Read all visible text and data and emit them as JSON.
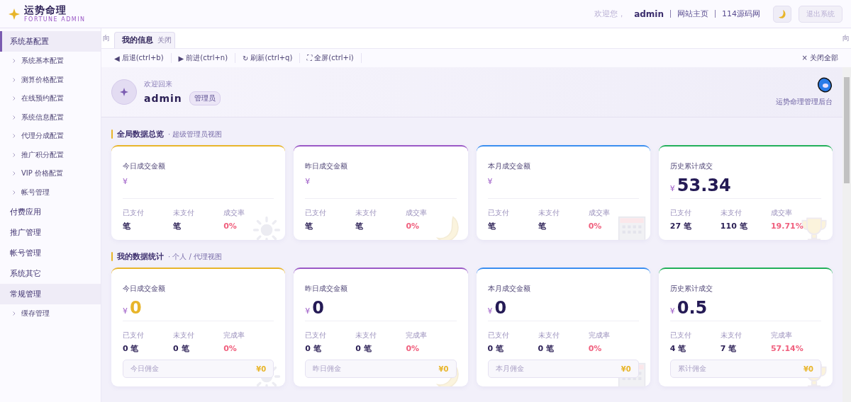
{
  "brand": {
    "title": "运势命理",
    "subtitle": "FORTUNE ADMIN"
  },
  "header": {
    "greeting": "欢迎您，",
    "user": "admin",
    "links": [
      "网站主页",
      "114源码网"
    ],
    "logout": "退出系统"
  },
  "sidebar": {
    "items": [
      {
        "label": "系统基配置",
        "selected": true,
        "expanded": true,
        "children": [
          {
            "label": "系统基本配置"
          },
          {
            "label": "测算价格配置"
          },
          {
            "label": "在线预约配置"
          },
          {
            "label": "系统信息配置"
          },
          {
            "label": "代理分成配置"
          },
          {
            "label": "推广积分配置"
          },
          {
            "label": "VIP 价格配置"
          },
          {
            "label": "帐号管理"
          }
        ]
      },
      {
        "label": "付费应用",
        "selected": false,
        "expanded": false
      },
      {
        "label": "推广管理",
        "selected": false,
        "expanded": false
      },
      {
        "label": "帐号管理",
        "selected": false,
        "expanded": false
      },
      {
        "label": "系统其它",
        "selected": false,
        "expanded": false
      },
      {
        "label": "常规管理",
        "selected": false,
        "expanded": true,
        "children": [
          {
            "label": "缓存管理"
          }
        ]
      }
    ]
  },
  "tab_bar": {
    "left_arrow": "向",
    "right_arrow": "向",
    "tabs": [
      {
        "label": "我的信息",
        "close": "关闭",
        "selected": true
      }
    ]
  },
  "toolbar": {
    "buttons": [
      {
        "icon": "◀",
        "label": "后退(ctrl+b)"
      },
      {
        "icon": "▶",
        "label": "前进(ctrl+n)"
      },
      {
        "icon": "↻",
        "label": "刷新(ctrl+q)"
      },
      {
        "icon": "⛶",
        "label": "全屏(ctrl+i)"
      }
    ],
    "close_all": "× 关闭全部"
  },
  "welcome": {
    "greeting": "欢迎回来",
    "user": "admin",
    "role": "管理员",
    "app_name": "运势命理管理后台"
  },
  "sections": [
    {
      "title": "全局数据总览",
      "subtitle": "· 超级管理员视图",
      "cards": [
        {
          "kind": "sun",
          "color": "#e8b52a",
          "title": "今日成交金额",
          "currency": "¥",
          "stats": [
            {
              "label": "已支付",
              "value": "笔"
            },
            {
              "label": "未支付",
              "value": "笔"
            },
            {
              "label": "成交率",
              "value": "0%"
            }
          ]
        },
        {
          "kind": "moon",
          "color": "#9b59c6",
          "title": "昨日成交金额",
          "currency": "¥",
          "stats": [
            {
              "label": "已支付",
              "value": "笔"
            },
            {
              "label": "未支付",
              "value": "笔"
            },
            {
              "label": "成交率",
              "value": "0%"
            }
          ]
        },
        {
          "kind": "calendar",
          "color": "#3a8ef0",
          "title": "本月成交金额",
          "currency": "¥",
          "stats": [
            {
              "label": "已支付",
              "value": "笔"
            },
            {
              "label": "未支付",
              "value": "笔"
            },
            {
              "label": "成交率",
              "value": "0%"
            }
          ]
        },
        {
          "kind": "trophy",
          "color": "#22b05a",
          "title": "历史累计成交",
          "currency": "¥",
          "amount": "53.34",
          "stats": [
            {
              "label": "已支付",
              "value": "27 笔"
            },
            {
              "label": "未支付",
              "value": "110 笔"
            },
            {
              "label": "成交率",
              "value": "19.71%"
            }
          ]
        }
      ]
    },
    {
      "title": "我的数据统计",
      "subtitle": "· 个人 / 代理视图",
      "cards": [
        {
          "kind": "sun",
          "color": "#e8b52a",
          "title": "今日成交金额",
          "currency": "¥",
          "amount": "0",
          "highlight": true,
          "stats": [
            {
              "label": "已支付",
              "value": "0 笔"
            },
            {
              "label": "未支付",
              "value": "0 笔"
            },
            {
              "label": "完成率",
              "value": "0%"
            }
          ],
          "commission": {
            "label": "今日佣金",
            "value": "¥0"
          }
        },
        {
          "kind": "moon",
          "color": "#9b59c6",
          "title": "昨日成交金额",
          "currency": "¥",
          "amount": "0",
          "highlight": false,
          "stats": [
            {
              "label": "已支付",
              "value": "0 笔"
            },
            {
              "label": "未支付",
              "value": "0 笔"
            },
            {
              "label": "完成率",
              "value": "0%"
            }
          ],
          "commission": {
            "label": "昨日佣金",
            "value": "¥0"
          }
        },
        {
          "kind": "calendar",
          "color": "#3a8ef0",
          "title": "本月成交金额",
          "currency": "¥",
          "amount": "0",
          "highlight": false,
          "stats": [
            {
              "label": "已支付",
              "value": "0 笔"
            },
            {
              "label": "未支付",
              "value": "0 笔"
            },
            {
              "label": "完成率",
              "value": "0%"
            }
          ],
          "commission": {
            "label": "本月佣金",
            "value": "¥0"
          }
        },
        {
          "kind": "trophy",
          "color": "#22b05a",
          "title": "历史累计成交",
          "currency": "¥",
          "amount": "0.5",
          "highlight": false,
          "stats": [
            {
              "label": "已支付",
              "value": "4 笔"
            },
            {
              "label": "未支付",
              "value": "7 笔"
            },
            {
              "label": "完成率",
              "value": "57.14%"
            }
          ],
          "commission": {
            "label": "累计佣金",
            "value": "¥0"
          }
        }
      ]
    }
  ]
}
